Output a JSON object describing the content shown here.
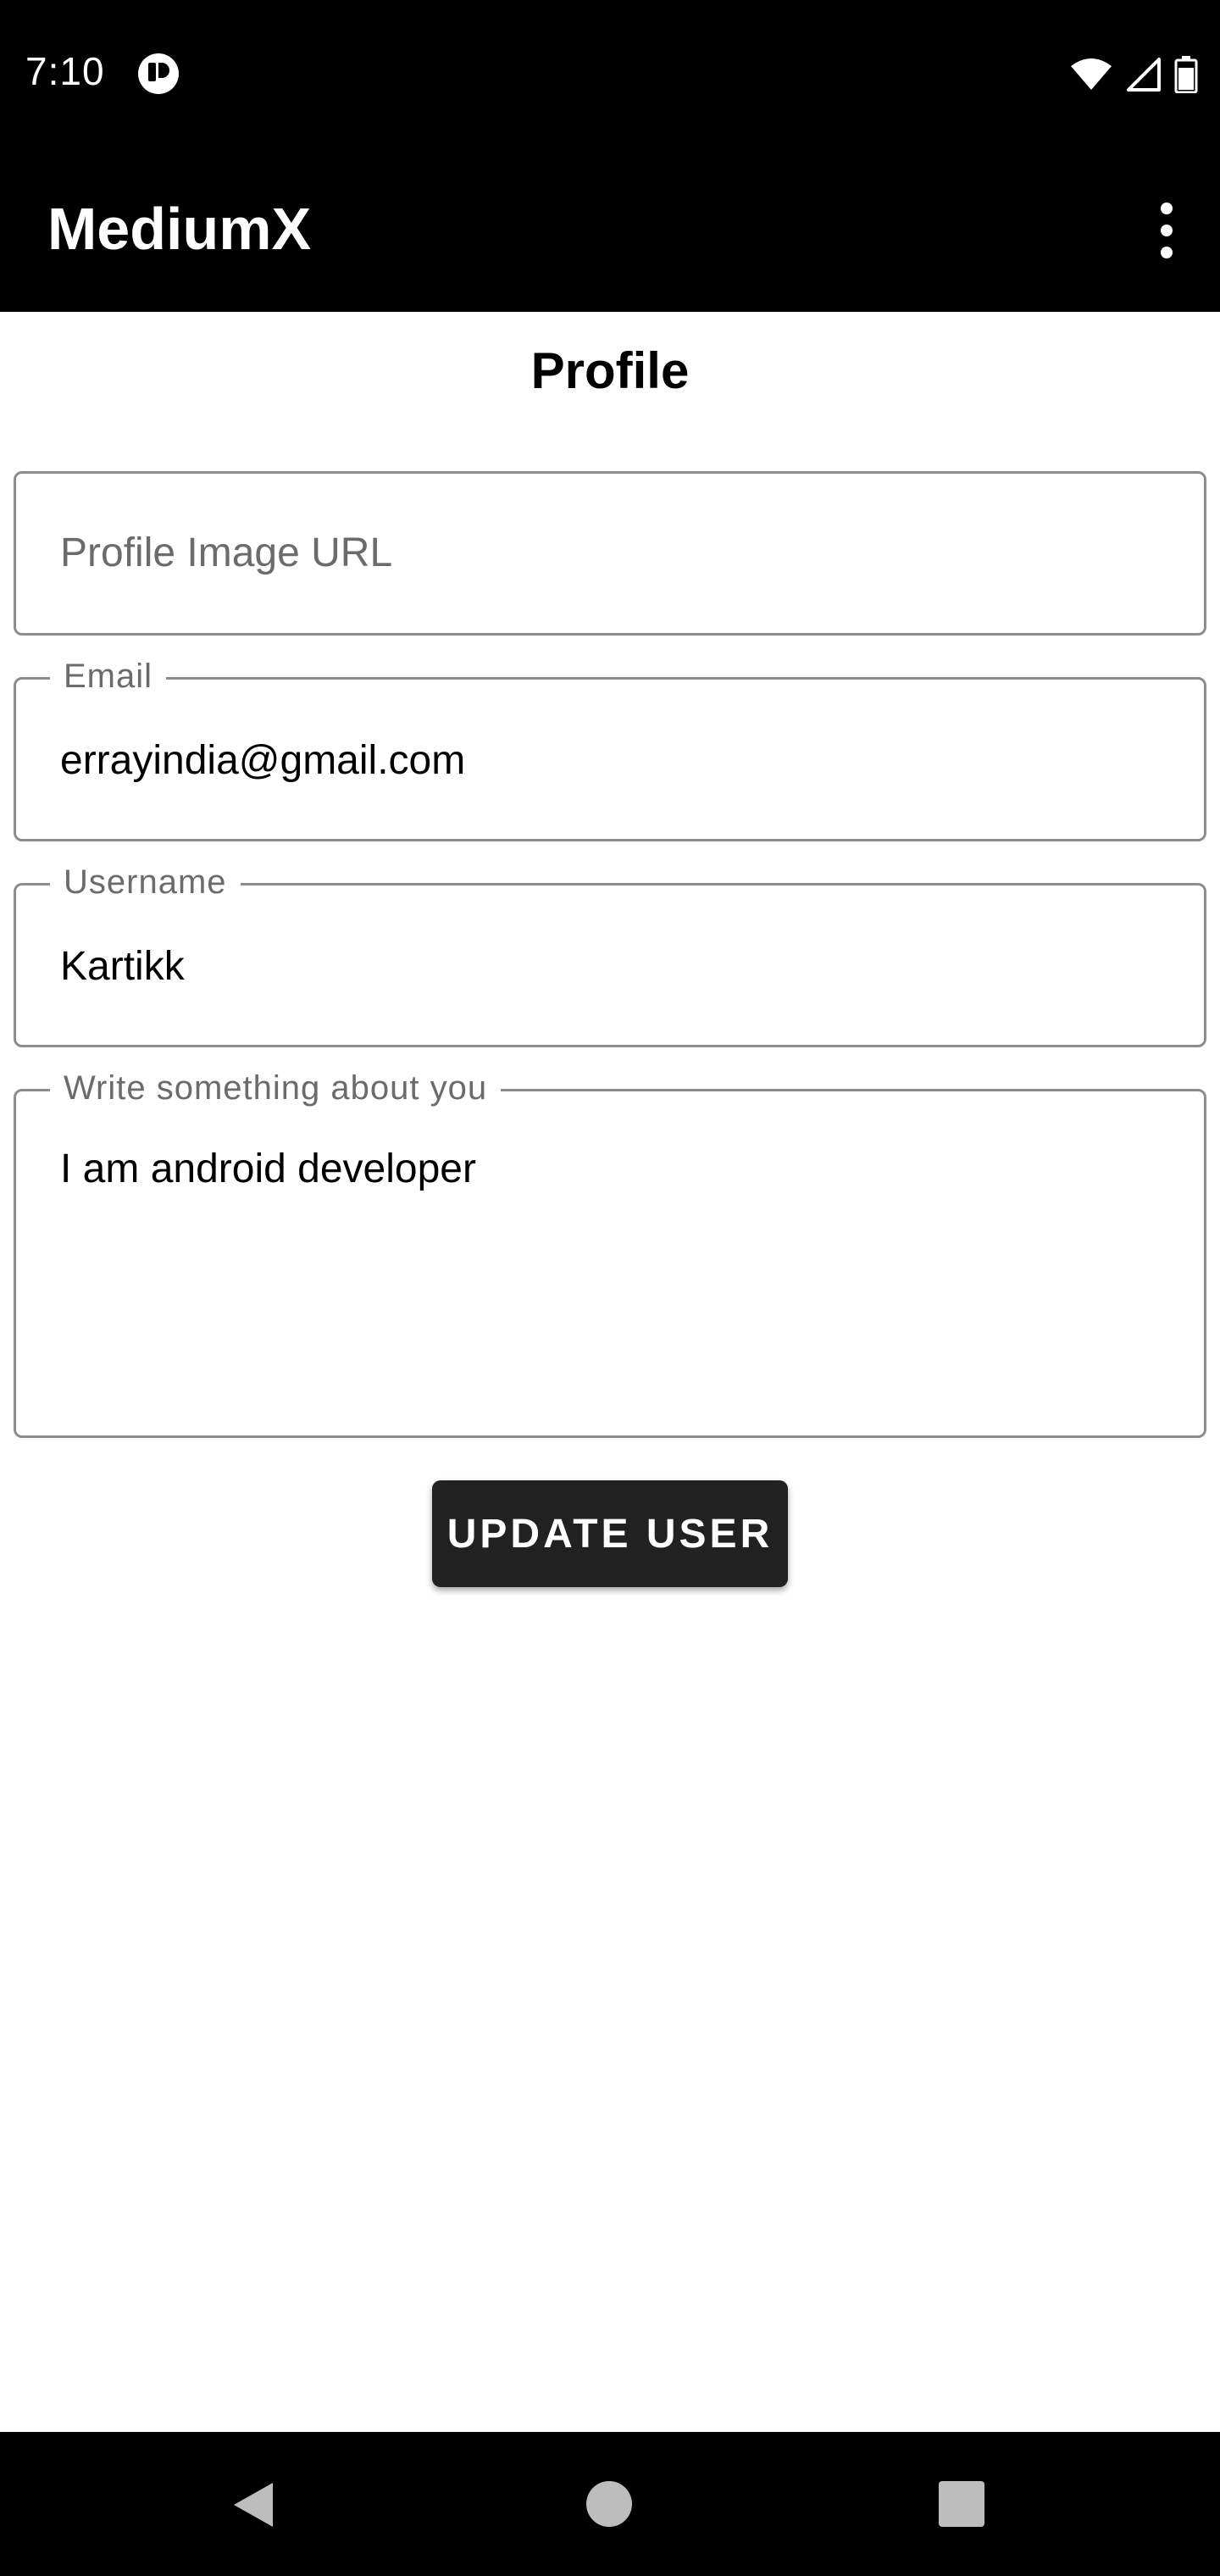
{
  "status_bar": {
    "time": "7:10",
    "icons": [
      "app-notification-icon",
      "wifi-icon",
      "cellular-signal-icon",
      "battery-icon"
    ]
  },
  "app_bar": {
    "title": "MediumX",
    "menu_icon": "overflow-menu-icon"
  },
  "page": {
    "title": "Profile"
  },
  "form": {
    "profile_image_url": {
      "placeholder": "Profile Image URL",
      "value": ""
    },
    "email": {
      "label": "Email",
      "value": "errayindia@gmail.com"
    },
    "username": {
      "label": "Username",
      "value": "Kartikk"
    },
    "bio": {
      "label": "Write something about you",
      "value": "I am android developer"
    },
    "submit_label": "UPDATE USER"
  },
  "nav_bar": {
    "icons": [
      "back-icon",
      "home-icon",
      "recents-icon"
    ]
  },
  "colors": {
    "bars": "#000000",
    "button": "#212121",
    "border": "#8c8c8c",
    "label": "#6b6b6b"
  }
}
